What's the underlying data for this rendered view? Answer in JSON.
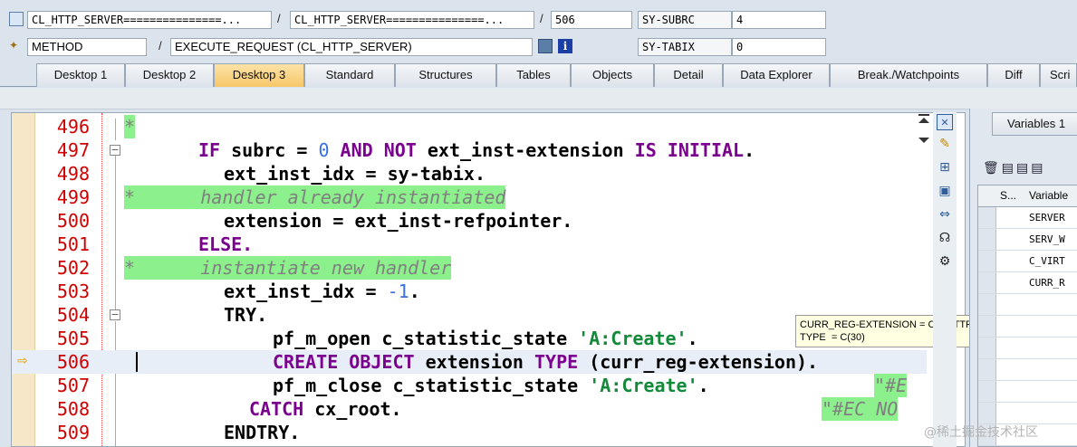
{
  "header": {
    "row1": {
      "class_field": "CL_HTTP_SERVER===============...",
      "class_field2": "CL_HTTP_SERVER===============...",
      "line_field": "506",
      "sys_label": "SY-SUBRC",
      "sys_value": "4"
    },
    "row2": {
      "type_field": "METHOD",
      "method_field": "EXECUTE_REQUEST (CL_HTTP_SERVER)",
      "sys_label": "SY-TABIX",
      "sys_value": "0"
    },
    "separator": "/"
  },
  "tabs": [
    {
      "label": "Desktop 1"
    },
    {
      "label": "Desktop 2"
    },
    {
      "label": "Desktop 3"
    },
    {
      "label": "Standard"
    },
    {
      "label": "Structures"
    },
    {
      "label": "Tables"
    },
    {
      "label": "Objects"
    },
    {
      "label": "Detail"
    },
    {
      "label": "Data Explorer"
    },
    {
      "label": "Break./Watchpoints"
    },
    {
      "label": "Diff"
    },
    {
      "label": "Scri"
    }
  ],
  "active_tab": "Desktop 3",
  "code_lines": [
    {
      "num": "496"
    },
    {
      "num": "497"
    },
    {
      "num": "498"
    },
    {
      "num": "499"
    },
    {
      "num": "500"
    },
    {
      "num": "501"
    },
    {
      "num": "502"
    },
    {
      "num": "503"
    },
    {
      "num": "504"
    },
    {
      "num": "505"
    },
    {
      "num": "506"
    },
    {
      "num": "507"
    },
    {
      "num": "508"
    },
    {
      "num": "509"
    }
  ],
  "code_text": {
    "l496": "*",
    "l497_if": "IF",
    "l497_subrc": " subrc = ",
    "l497_zero": "0",
    "l497_and": " AND NOT",
    "l497_ext": " ext_inst-extension ",
    "l497_is": "IS INITIAL",
    "l497_dot": ".",
    "l498": "ext_inst_idx = sy-tabix.",
    "l499": "*      handler already instantiated",
    "l500": "extension = ext_inst-refpointer.",
    "l501": "ELSE.",
    "l502": "*      instantiate new handler",
    "l503_a": "ext_inst_idx = ",
    "l503_n": "-1",
    "l503_dot": ".",
    "l504": "TRY.",
    "l505_a": "pf_m_open c_statistic_state ",
    "l505_s": "'A:Create'",
    "l505_dot": ".",
    "l506_kw": "CREATE OBJECT",
    "l506_a": " extension ",
    "l506_type": "TYPE",
    "l506_b": " (curr_reg-extension).",
    "l507_a": "pf_m_close c_statistic_state ",
    "l507_s": "'A:Create'",
    "l507_dot": ".",
    "l507_c": "\"#E",
    "l508_kw": "CATCH",
    "l508_a": " cx_root.",
    "l508_c": "\"#EC NO",
    "l509": "ENDTRY."
  },
  "tooltip": {
    "line1": "CURR_REG-EXTENSION = CL_HTTP_EXT_BSP",
    "line2": "TYPE  = C(30)"
  },
  "variables": {
    "tab_label": "Variables 1",
    "col_s": "S...",
    "col_var": "Variable",
    "rows": [
      "SERVER",
      "SERV_W",
      "C_VIRT",
      "CURR_R"
    ]
  },
  "watermark": "@稀土掘金技术社区",
  "colors": {
    "line_number": "#d10000",
    "keyword": "#7b008f",
    "string": "#138a3a",
    "comment_bg": "#8cf08c",
    "active_tab": "#f7c768",
    "current_line": "#e8eef7"
  }
}
